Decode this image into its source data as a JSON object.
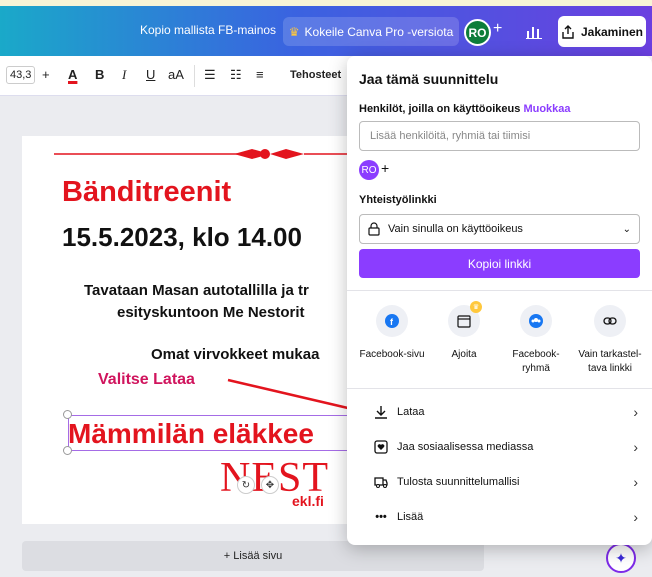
{
  "topbar": {
    "doc_title": "Kopio mallista FB-mainos",
    "pro_button": "Kokeile Canva Pro -versiota",
    "avatar_initials": "RO",
    "plus": "+",
    "share_button": "Jakaminen"
  },
  "toolbar": {
    "font_size": "43,3",
    "plus": "+",
    "text_color": "A",
    "bold": "B",
    "italic": "I",
    "underline": "U",
    "case": "aA",
    "effects": "Tehosteet"
  },
  "canvas": {
    "title": "Bänditreenit",
    "date": "15.5.2023, klo 14.00",
    "line1": "Tavataan Masan autotallilla ja tr",
    "line2": "esityskuntoon Me Nestorit",
    "line3": "Omat virvokkeet mukaa",
    "selected_text": "Mämmilän eläkkee",
    "logo": "NEST",
    "logo_sub": "ekl.fi",
    "add_page": "+ Lisää sivu"
  },
  "annotation": "Valitse Lataa",
  "share_panel": {
    "title": "Jaa tämä suunnittelu",
    "people_label": "Henkilöt, joilla on käyttöoikeus",
    "edit_link": "Muokkaa",
    "people_placeholder": "Lisää henkilöitä, ryhmiä tai tiimisi",
    "avatar_initials": "RO",
    "avatar_plus": "+",
    "link_label": "Yhteistyölinkki",
    "access_value": "Vain sinulla on käyttöoikeus",
    "copy_link": "Kopioi linkki",
    "share_options": [
      {
        "icon": "facebook-icon",
        "line1": "Facebook-sivu",
        "line2": ""
      },
      {
        "icon": "calendar-icon",
        "line1": "Ajoita",
        "line2": ""
      },
      {
        "icon": "group-icon",
        "line1": "Facebook-",
        "line2": "ryhmä"
      },
      {
        "icon": "link-icon",
        "line1": "Vain tarkastel-",
        "line2": "tava linkki"
      }
    ],
    "list": [
      {
        "icon": "download-icon",
        "label": "Lataa"
      },
      {
        "icon": "heart-icon",
        "label": "Jaa sosiaalisessa mediassa"
      },
      {
        "icon": "truck-icon",
        "label": "Tulosta suunnittelumallisi"
      },
      {
        "icon": "more-icon",
        "label": "Lisää"
      }
    ]
  },
  "colors": {
    "accent": "#8b3dff",
    "red": "#e3141e",
    "annotation": "#d0145d"
  }
}
